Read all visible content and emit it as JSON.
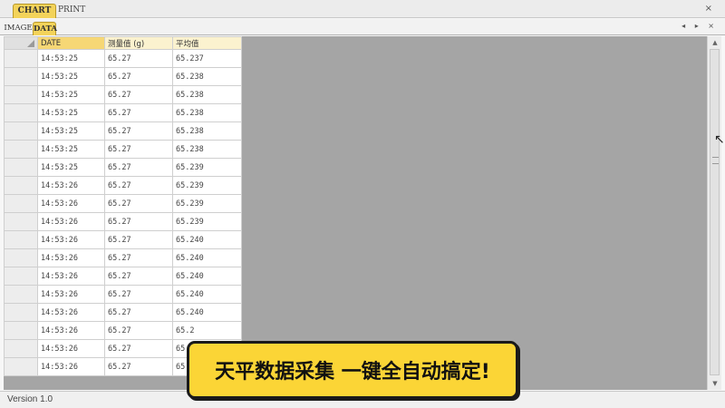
{
  "top_tabs": {
    "chart": "CHART",
    "print": "PRINT",
    "close": "×"
  },
  "sub_tabs": {
    "image": "IMAGE",
    "data": "DATA",
    "controls": "◂ ▸ ×"
  },
  "table": {
    "headers": {
      "date": "DATE",
      "measured": "测量值 (g)",
      "average": "平均值"
    },
    "rows": [
      [
        "14:53:25",
        "65.27",
        "65.237"
      ],
      [
        "14:53:25",
        "65.27",
        "65.238"
      ],
      [
        "14:53:25",
        "65.27",
        "65.238"
      ],
      [
        "14:53:25",
        "65.27",
        "65.238"
      ],
      [
        "14:53:25",
        "65.27",
        "65.238"
      ],
      [
        "14:53:25",
        "65.27",
        "65.238"
      ],
      [
        "14:53:25",
        "65.27",
        "65.239"
      ],
      [
        "14:53:26",
        "65.27",
        "65.239"
      ],
      [
        "14:53:26",
        "65.27",
        "65.239"
      ],
      [
        "14:53:26",
        "65.27",
        "65.239"
      ],
      [
        "14:53:26",
        "65.27",
        "65.240"
      ],
      [
        "14:53:26",
        "65.27",
        "65.240"
      ],
      [
        "14:53:26",
        "65.27",
        "65.240"
      ],
      [
        "14:53:26",
        "65.27",
        "65.240"
      ],
      [
        "14:53:26",
        "65.27",
        "65.240"
      ],
      [
        "14:53:26",
        "65.27",
        "65.2"
      ],
      [
        "14:53:26",
        "65.27",
        "65.2"
      ],
      [
        "14:53:26",
        "65.27",
        "65.2"
      ]
    ]
  },
  "status": {
    "version": "Version 1.0"
  },
  "caption": {
    "text": "天平数据采集 一键全自动搞定!"
  },
  "icons": {
    "scroll_up": "up-arrow-icon",
    "scroll_down": "down-arrow-icon",
    "cursor": "mouse-cursor-icon",
    "grid_corner": "select-all-icon"
  },
  "colors": {
    "tab_active": "#f3d35a",
    "header_active": "#f6d775",
    "grid_background": "#a5a5a5",
    "caption_background": "#fbd536"
  }
}
